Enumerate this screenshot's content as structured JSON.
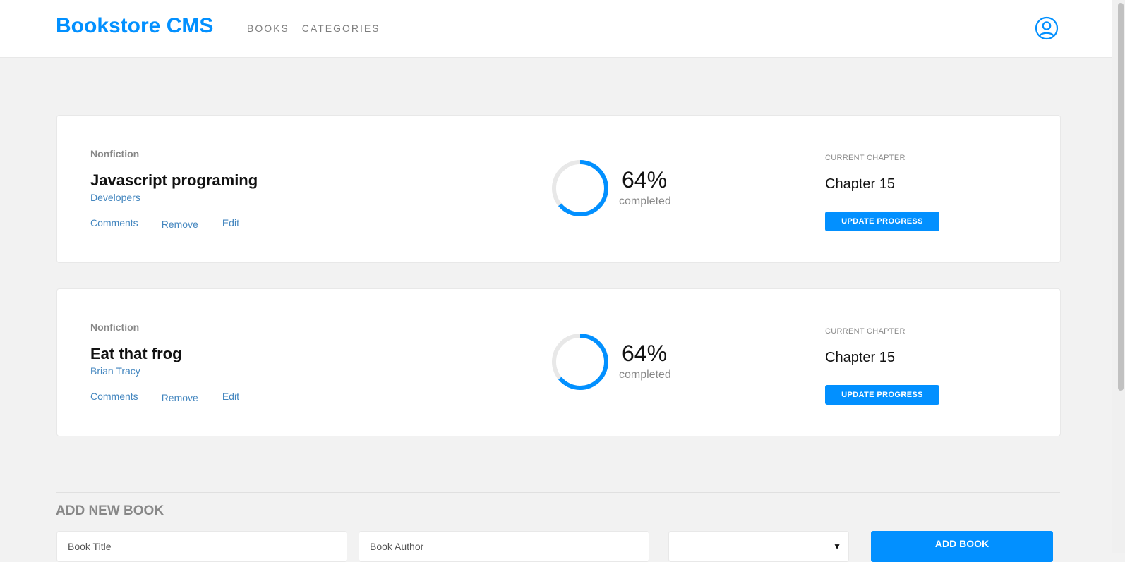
{
  "header": {
    "logo": "Bookstore CMS",
    "nav": [
      "BOOKS",
      "CATEGORIES"
    ],
    "accent_color": "#0290ff",
    "user_icon": "user-circle-icon"
  },
  "books": [
    {
      "genre": "Nonfiction",
      "title": "Javascript programing",
      "author": "Developers",
      "actions": [
        "Comments",
        "Remove",
        "Edit"
      ],
      "progress_percent": 64,
      "percent_label": "64%",
      "completed_label": "completed",
      "chapter_label": "CURRENT CHAPTER",
      "chapter": "Chapter 15",
      "update_label": "UPDATE PROGRESS"
    },
    {
      "genre": "Nonfiction",
      "title": "Eat that frog",
      "author": "Brian Tracy",
      "actions": [
        "Comments",
        "Remove",
        "Edit"
      ],
      "progress_percent": 64,
      "percent_label": "64%",
      "completed_label": "completed",
      "chapter_label": "CURRENT CHAPTER",
      "chapter": "Chapter 15",
      "update_label": "UPDATE PROGRESS"
    }
  ],
  "add_form": {
    "heading": "ADD NEW BOOK",
    "title_placeholder": "Book Title",
    "author_placeholder": "Book Author",
    "category_value": "",
    "button_label": "ADD BOOK"
  }
}
